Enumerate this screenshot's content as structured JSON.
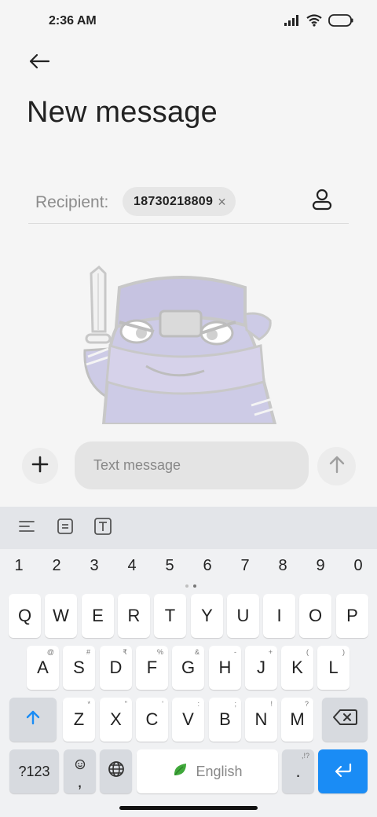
{
  "status": {
    "time": "2:36 AM"
  },
  "title": "New message",
  "recipient": {
    "label": "Recipient:",
    "chip_number": "18730218809",
    "chip_close": "×"
  },
  "compose": {
    "placeholder": "Text message"
  },
  "keyboard": {
    "numbers": [
      "1",
      "2",
      "3",
      "4",
      "5",
      "6",
      "7",
      "8",
      "9",
      "0"
    ],
    "row1": [
      "Q",
      "W",
      "E",
      "R",
      "T",
      "Y",
      "U",
      "I",
      "O",
      "P"
    ],
    "row2": [
      {
        "key": "A",
        "hint": "@"
      },
      {
        "key": "S",
        "hint": "#"
      },
      {
        "key": "D",
        "hint": "₹"
      },
      {
        "key": "F",
        "hint": "%"
      },
      {
        "key": "G",
        "hint": "&"
      },
      {
        "key": "H",
        "hint": "-"
      },
      {
        "key": "J",
        "hint": "+"
      },
      {
        "key": "K",
        "hint": "("
      },
      {
        "key": "L",
        "hint": ")"
      }
    ],
    "row3": [
      {
        "key": "Z",
        "hint": "*"
      },
      {
        "key": "X",
        "hint": "\""
      },
      {
        "key": "C",
        "hint": "'"
      },
      {
        "key": "V",
        "hint": ":"
      },
      {
        "key": "B",
        "hint": ";"
      },
      {
        "key": "N",
        "hint": "!"
      },
      {
        "key": "M",
        "hint": "?"
      }
    ],
    "sym_label": "?123",
    "emoji_key_label": ",",
    "space_label": "English",
    "period_label": ".",
    "period_hint": ",!?"
  },
  "colors": {
    "accent": "#1a8cf5",
    "keyboard_bg": "#f0f1f3"
  },
  "icons": {
    "back": "arrow-left-icon",
    "contact": "person-icon",
    "add": "plus-icon",
    "send": "arrow-up-icon",
    "shift": "shift-arrow-icon",
    "backspace": "backspace-icon",
    "globe": "globe-icon",
    "enter": "enter-arrow-icon",
    "space_logo": "leaf-icon"
  }
}
